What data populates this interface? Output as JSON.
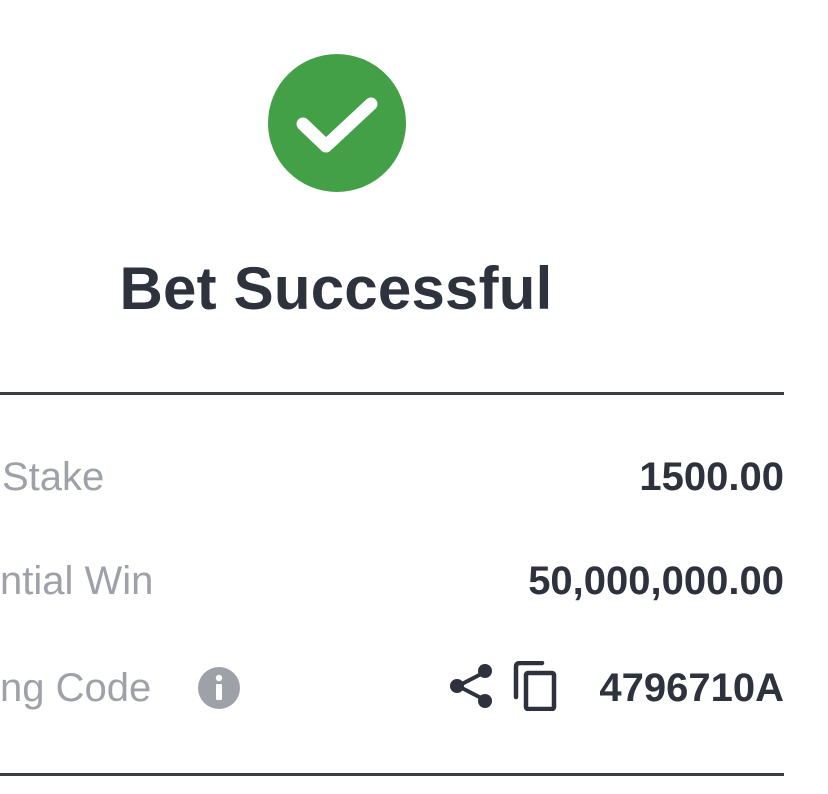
{
  "status": {
    "title": "Bet Successful",
    "icon": "check-circle-icon",
    "color": "#43a047"
  },
  "details": {
    "stake_label": "Stake",
    "stake_value": "1500.00",
    "potential_win_label": "ntial Win",
    "potential_win_value": "50,000,000.00",
    "booking_code_label": "ng Code",
    "booking_code_value": "4796710A"
  },
  "icons": {
    "info": "info-icon",
    "share": "share-icon",
    "copy": "copy-icon"
  }
}
